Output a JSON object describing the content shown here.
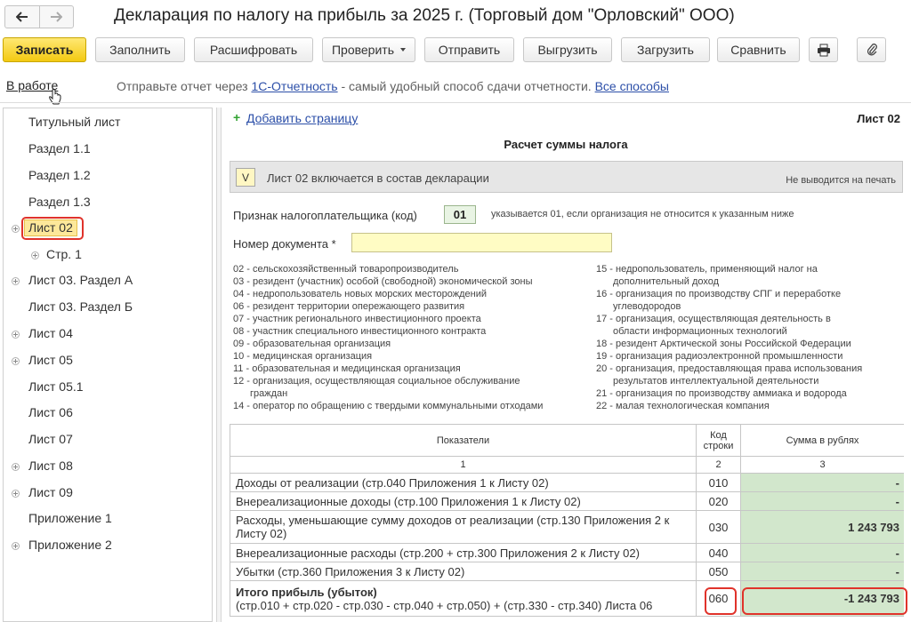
{
  "window": {
    "title": "Декларация по налогу на прибыль за 2025 г. (Торговый дом \"Орловский\" ООО)"
  },
  "toolbar": {
    "save": "Записать",
    "fill": "Заполнить",
    "decode": "Расшифровать",
    "check": "Проверить",
    "send": "Отправить",
    "export": "Выгрузить",
    "import": "Загрузить",
    "compare": "Сравнить"
  },
  "status": {
    "state": "В работе",
    "info_prefix": "Отправьте отчет через ",
    "info_link": "1С-Отчетность",
    "info_middle": " - самый удобный способ сдачи отчетности. ",
    "info_all": "Все способы"
  },
  "tree": {
    "items": [
      {
        "label": "Титульный лист"
      },
      {
        "label": "Раздел 1.1"
      },
      {
        "label": "Раздел 1.2"
      },
      {
        "label": "Раздел 1.3"
      },
      {
        "label": "Лист 02"
      },
      {
        "label": "Стр. 1"
      },
      {
        "label": "Лист 03. Раздел А"
      },
      {
        "label": "Лист 03. Раздел Б"
      },
      {
        "label": "Лист 04"
      },
      {
        "label": "Лист 05"
      },
      {
        "label": "Лист 05.1"
      },
      {
        "label": "Лист 06"
      },
      {
        "label": "Лист 07"
      },
      {
        "label": "Лист 08"
      },
      {
        "label": "Лист 09"
      },
      {
        "label": "Приложение 1"
      },
      {
        "label": "Приложение 2"
      }
    ]
  },
  "form": {
    "add_page": "Добавить страницу",
    "sheet_name": "Лист 02",
    "section_title": "Расчет суммы налога",
    "include_check": "V",
    "include_label": "Лист 02 включается в состав декларации",
    "print_note": "Не выводится на печать",
    "taxpayer_label": "Признак налогоплательщика (код)",
    "taxpayer_code": "01",
    "taxpayer_hint": "указывается 01, если организация не относится к указанным ниже",
    "docnum_label": "Номер документа *",
    "codes_left": [
      "02 - сельскохозяйственный товаропроизводитель",
      "03 - резидент (участник) особой (свободной) экономической зоны",
      "04 - недропользователь новых морских месторождений",
      "06 - резидент территории опережающего развития",
      "07 - участник регионального инвестиционного проекта",
      "08 - участник специального инвестиционного контракта",
      "09 - образовательная организация",
      "10 - медицинская организация",
      "11 - образовательная и медицинская организация",
      "12 - организация, осуществляющая социальное обслуживание",
      "граждан",
      "14 - оператор по обращению с твердыми коммунальными отходами"
    ],
    "codes_right": [
      "15 - недропользователь, применяющий налог на",
      "дополнительный доход",
      "16 - организация по производству СПГ и переработке",
      "углеводородов",
      "17 - организация, осуществляющая деятельность в",
      "области информационных технологий",
      "18 - резидент Арктической зоны Российской Федерации",
      "19 - организация радиоэлектронной промышленности",
      "20 - организация, предоставляющая права использования",
      "результатов интеллектуальной деятельности",
      "21 - организация по производству аммиака и водорода",
      "22 - малая технологическая компания"
    ]
  },
  "table": {
    "headers": {
      "indicator": "Показатели",
      "code_line1": "Код",
      "code_line2": "строки",
      "sum": "Сумма в рублях",
      "n1": "1",
      "n2": "2",
      "n3": "3"
    },
    "rows": [
      {
        "label": "Доходы от реализации (стр.040 Приложения 1 к Листу 02)",
        "code": "010",
        "sum": "-"
      },
      {
        "label": "Внереализационные доходы (стр.100 Приложения 1 к Листу 02)",
        "code": "020",
        "sum": "-"
      },
      {
        "label": "Расходы, уменьшающие сумму доходов от реализации (стр.130 Приложения 2 к Листу 02)",
        "code": "030",
        "sum": "1 243 793"
      },
      {
        "label": "Внереализационные расходы (стр.200 + стр.300 Приложения 2 к Листу 02)",
        "code": "040",
        "sum": "-"
      },
      {
        "label": "Убытки (стр.360 Приложения 3 к Листу 02)",
        "code": "050",
        "sum": "-"
      }
    ],
    "total": {
      "label": "Итого прибыль (убыток)",
      "formula": "(стр.010 + стр.020 - стр.030 - стр.040 + стр.050) + (стр.330 - стр.340) Листа 06",
      "code": "060",
      "sum": "-1 243 793"
    }
  }
}
